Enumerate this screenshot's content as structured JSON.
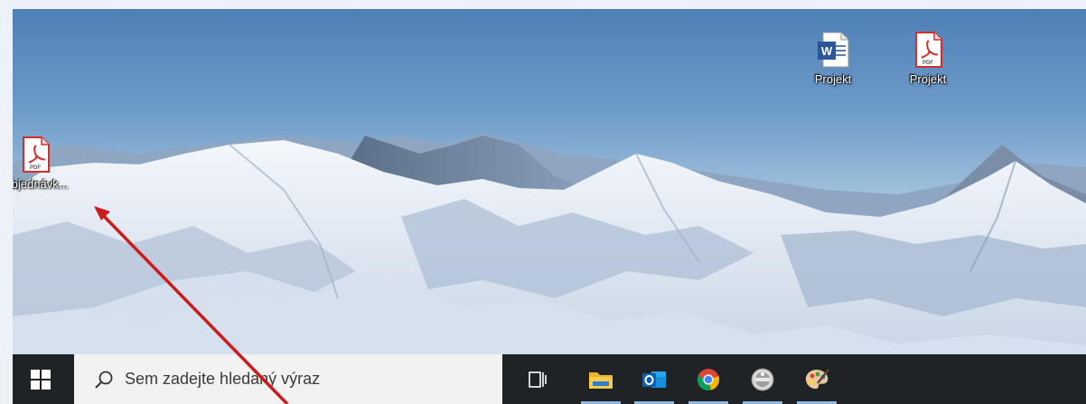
{
  "desktop": {
    "icons": [
      {
        "label": "Projekt",
        "type": "word-document"
      },
      {
        "label": "Projekt",
        "type": "pdf-document"
      },
      {
        "label": "Objednávk...",
        "type": "pdf-document"
      }
    ]
  },
  "taskbar": {
    "start_icon": "windows-logo-icon",
    "search": {
      "placeholder": "Sem zadejte hledaný výraz",
      "icon": "search-icon"
    },
    "apps": [
      {
        "name": "task-view",
        "icon": "task-view-icon",
        "running": false
      },
      {
        "name": "file-explorer",
        "icon": "folder-icon",
        "running": true
      },
      {
        "name": "outlook",
        "icon": "outlook-icon",
        "running": true
      },
      {
        "name": "chrome",
        "icon": "chrome-icon",
        "running": true
      },
      {
        "name": "app",
        "icon": "gray-circle-app-icon",
        "running": true
      },
      {
        "name": "paint",
        "icon": "palette-icon",
        "running": true
      }
    ]
  },
  "annotation": {
    "color": "#cc1b1b",
    "icon": "red-annotation-arrow"
  },
  "colors": {
    "taskbar": "#1f2326",
    "search_bg": "#f2f2f2",
    "running_indicator": "#8fb6df",
    "pdf_red": "#d32f2f",
    "word_blue": "#2b579a"
  }
}
